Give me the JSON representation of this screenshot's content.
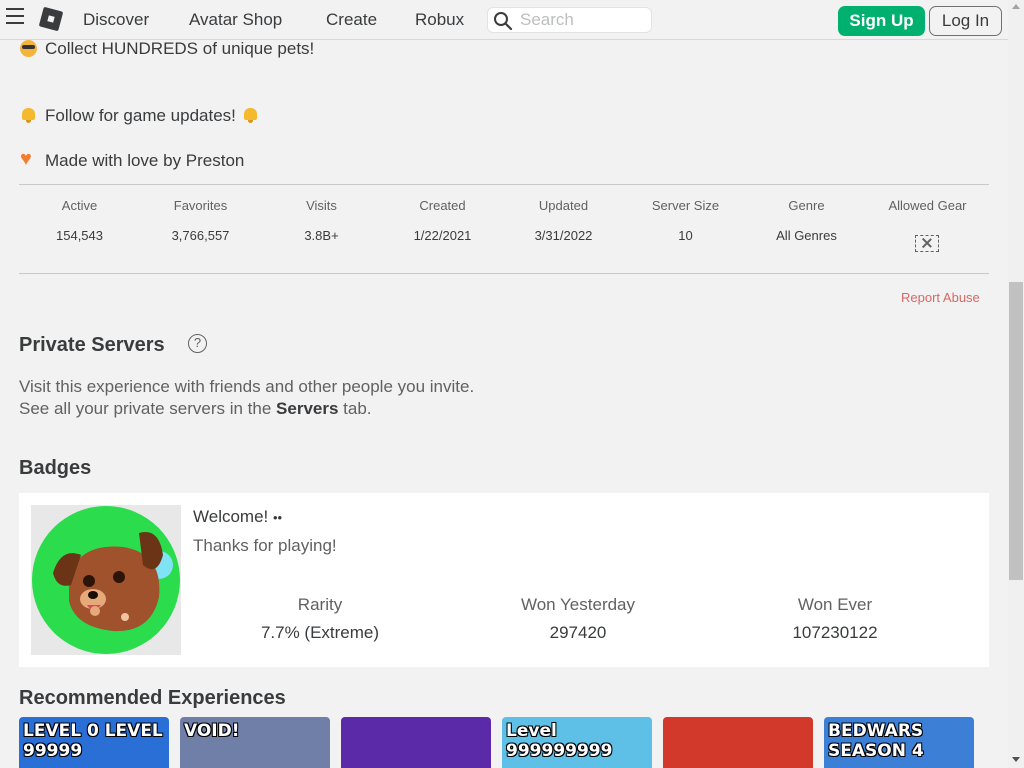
{
  "header": {
    "nav": [
      "Discover",
      "Avatar Shop",
      "Create",
      "Robux"
    ],
    "search_placeholder": "Search",
    "signup_label": "Sign Up",
    "login_label": "Log In"
  },
  "description": {
    "lines": [
      "Collect HUNDREDS of unique pets!",
      "Follow for game updates!",
      "Made with love by Preston"
    ]
  },
  "stats": {
    "labels": [
      "Active",
      "Favorites",
      "Visits",
      "Created",
      "Updated",
      "Server Size",
      "Genre",
      "Allowed Gear"
    ],
    "values": [
      "154,543",
      "3,766,557",
      "3.8B+",
      "1/22/2021",
      "3/31/2022",
      "10",
      "All Genres"
    ]
  },
  "report_abuse": "Report Abuse",
  "private_servers": {
    "title": "Private Servers",
    "help": "?",
    "line1": "Visit this experience with friends and other people you invite.",
    "line2_pre": "See all your private servers in the",
    "line2_link": "Servers",
    "line2_post": "tab."
  },
  "badges": {
    "title": "Badges",
    "badge": {
      "name": "Welcome!",
      "description": "Thanks for playing!",
      "stats": [
        {
          "label": "Rarity",
          "value": "7.7% (Extreme)"
        },
        {
          "label": "Won Yesterday",
          "value": "297420"
        },
        {
          "label": "Won Ever",
          "value": "107230122"
        }
      ]
    }
  },
  "recommended": {
    "title": "Recommended Experiences",
    "tiles": [
      {
        "caption": "LEVEL 0  LEVEL 99999",
        "color": "#2a6fd6"
      },
      {
        "caption": "VOID!",
        "color": "#6f7fa8"
      },
      {
        "caption": "",
        "color": "#5b2aa8"
      },
      {
        "caption": "Level 999999999",
        "color": "#5ec0e6"
      },
      {
        "caption": "",
        "color": "#d2392a"
      },
      {
        "caption": "BEDWARS SEASON 4",
        "color": "#3b7fd6"
      }
    ]
  },
  "colors": {
    "accent_green": "#00b06f",
    "report_red": "#d86868",
    "badge_bg": "#2bdc4d"
  }
}
